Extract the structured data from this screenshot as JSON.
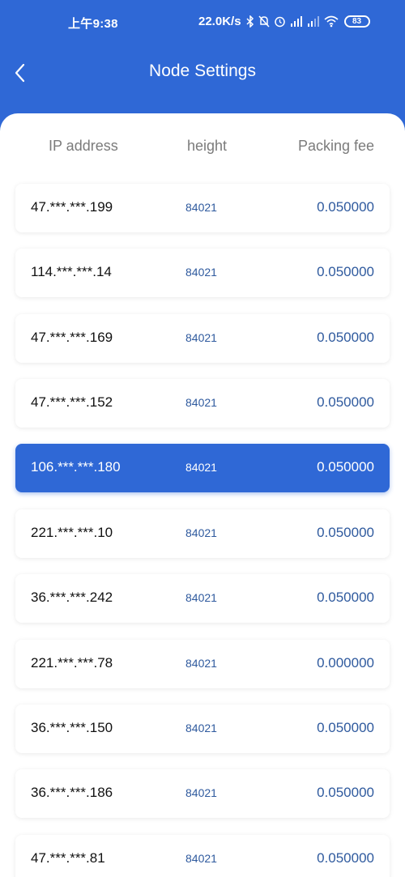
{
  "status_bar": {
    "time": "上午9:38",
    "speed": "22.0K/s",
    "battery": "83",
    "icons": [
      "bluetooth-icon",
      "mute-bell-icon",
      "alarm-icon",
      "hd-signal-icon",
      "signal-icon",
      "wifi-icon",
      "battery-icon"
    ]
  },
  "nav": {
    "title": "Node Settings",
    "back_icon": "chevron-left-icon"
  },
  "table": {
    "headers": {
      "ip": "IP address",
      "height": "height",
      "fee": "Packing fee"
    },
    "rows": [
      {
        "ip": "47.***.***.199",
        "height": "84021",
        "fee": "0.050000",
        "selected": false
      },
      {
        "ip": "114.***.***.14",
        "height": "84021",
        "fee": "0.050000",
        "selected": false
      },
      {
        "ip": "47.***.***.169",
        "height": "84021",
        "fee": "0.050000",
        "selected": false
      },
      {
        "ip": "47.***.***.152",
        "height": "84021",
        "fee": "0.050000",
        "selected": false
      },
      {
        "ip": "106.***.***.180",
        "height": "84021",
        "fee": "0.050000",
        "selected": true
      },
      {
        "ip": "221.***.***.10",
        "height": "84021",
        "fee": "0.050000",
        "selected": false
      },
      {
        "ip": "36.***.***.242",
        "height": "84021",
        "fee": "0.050000",
        "selected": false
      },
      {
        "ip": "221.***.***.78",
        "height": "84021",
        "fee": "0.000000",
        "selected": false
      },
      {
        "ip": "36.***.***.150",
        "height": "84021",
        "fee": "0.050000",
        "selected": false
      },
      {
        "ip": "36.***.***.186",
        "height": "84021",
        "fee": "0.050000",
        "selected": false
      },
      {
        "ip": "47.***.***.81",
        "height": "84021",
        "fee": "0.050000",
        "selected": false
      }
    ]
  },
  "colors": {
    "accent": "#2f68d6",
    "value_text": "#2f5a9e"
  }
}
